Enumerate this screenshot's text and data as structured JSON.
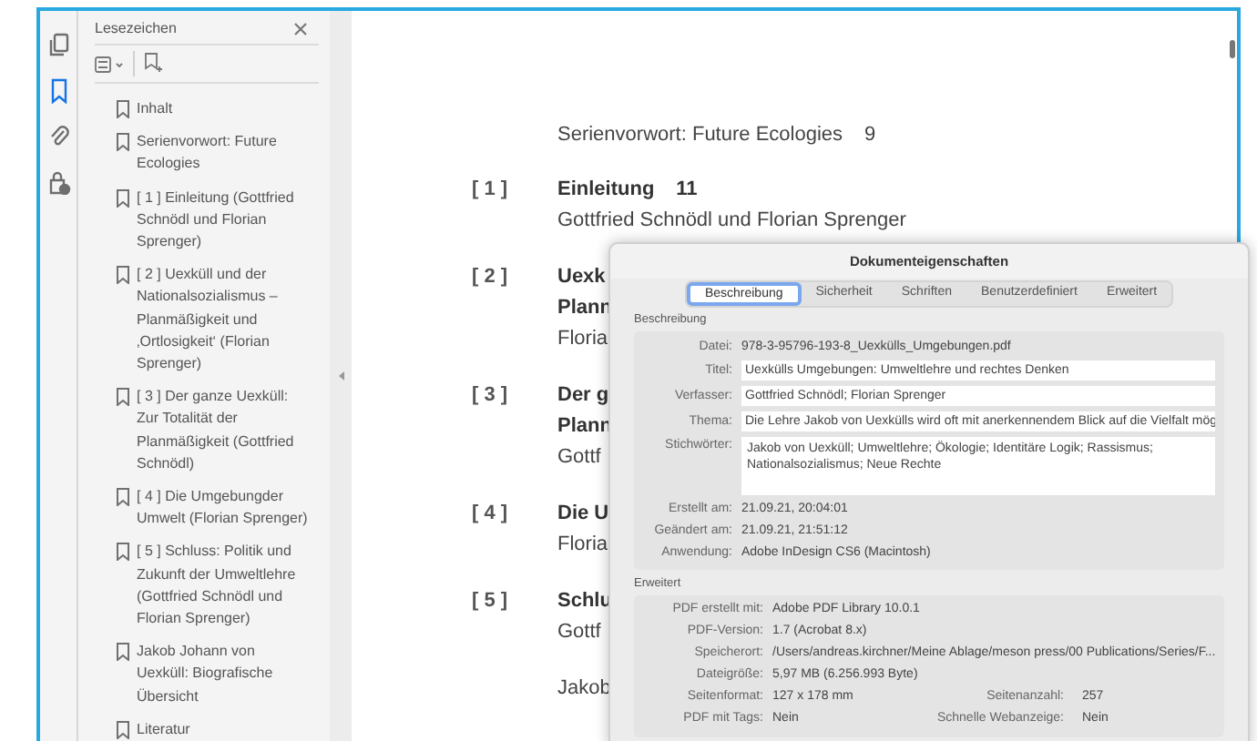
{
  "rail": [
    {
      "kind": "pages",
      "selected": false
    },
    {
      "kind": "bookmarks",
      "selected": true
    },
    {
      "kind": "attachments",
      "selected": false
    },
    {
      "kind": "security",
      "selected": false
    }
  ],
  "bookmarks_panel": {
    "title": "Lesezeichen",
    "items": [
      {
        "label": "Inhalt"
      },
      {
        "label": "Serienvorwort: Future Ecologies"
      },
      {
        "label": "[ 1 ] Einleitung (Gottfried Schnödl und Florian Sprenger)"
      },
      {
        "label": "[ 2 ] Uexküll und der Nationalsozialismus – Planmäßigkeit und ‚Ortlosigkeit‘ (Florian Sprenger)"
      },
      {
        "label": "[ 3 ] Der ganze Uexküll: Zur Totalität der Planmäßigkeit (Gottfried Schnödl)"
      },
      {
        "label": "[ 4 ] Die Umgebungder Umwelt (Florian Sprenger)"
      },
      {
        "label": "[ 5 ] Schluss: Politik und Zukunft der Umweltlehre (Gottfried Schnödl und Florian Sprenger)"
      },
      {
        "label": "Jakob Johann von Uexküll: Biografische Übersicht"
      },
      {
        "label": "Literatur"
      }
    ]
  },
  "document": {
    "entries": [
      {
        "kind": "plain",
        "text": "Serienvorwort: Future Ecologies",
        "page": "9"
      },
      {
        "kind": "chapter",
        "number": "[ 1 ]",
        "title_lines": [
          "Einleitung"
        ],
        "page": "11",
        "author": "Gottfried Schnödl und Florian Sprenger"
      },
      {
        "kind": "chapter",
        "number": "[ 2 ]",
        "title_lines": [
          "Uexk",
          "Plann"
        ],
        "author": "Floria"
      },
      {
        "kind": "chapter",
        "number": "[ 3 ]",
        "title_lines": [
          "Der g",
          "Plann"
        ],
        "author": "Gottf"
      },
      {
        "kind": "chapter",
        "number": "[ 4 ]",
        "title_lines": [
          "Die U"
        ],
        "author": "Floria"
      },
      {
        "kind": "chapter",
        "number": "[ 5 ]",
        "title_lines": [
          "Schlu"
        ],
        "author": "Gottf"
      },
      {
        "kind": "plain",
        "text": "Jakob"
      }
    ]
  },
  "dialog": {
    "title": "Dokumenteigenschaften",
    "tabs": [
      {
        "label": "Beschreibung",
        "selected": true
      },
      {
        "label": "Sicherheit",
        "selected": false
      },
      {
        "label": "Schriften",
        "selected": false
      },
      {
        "label": "Benutzerdefiniert",
        "selected": false
      },
      {
        "label": "Erweitert",
        "selected": false
      }
    ],
    "sections": [
      {
        "heading": "Beschreibung",
        "rows": [
          {
            "kind": "text",
            "label": "Datei:",
            "value": "978-3-95796-193-8_Uexkülls_Umgebungen.pdf"
          },
          {
            "kind": "input",
            "label": "Titel:",
            "value": "Uexkülls Umgebungen: Umweltlehre und rechtes Denken"
          },
          {
            "kind": "input",
            "label": "Verfasser:",
            "value": "Gottfried Schnödl; Florian Sprenger"
          },
          {
            "kind": "input",
            "label": "Thema:",
            "value": "Die Lehre Jakob von Uexkülls wird oft mit anerkennendem Blick auf die Vielfalt mög"
          },
          {
            "kind": "textarea",
            "label": "Stichwörter:",
            "value": "Jakob von Uexküll; Umweltlehre; Ökologie; Identitäre Logik; Rassismus; Nationalsozialismus; Neue Rechte"
          },
          {
            "kind": "text",
            "label": "Erstellt am:",
            "value": "21.09.21, 20:04:01"
          },
          {
            "kind": "text",
            "label": "Geändert am:",
            "value": "21.09.21, 21:51:12"
          },
          {
            "kind": "text",
            "label": "Anwendung:",
            "value": "Adobe InDesign CS6 (Macintosh)"
          }
        ]
      },
      {
        "heading": "Erweitert",
        "rows": [
          {
            "kind": "text",
            "label": "PDF erstellt mit:",
            "value": "Adobe PDF Library 10.0.1"
          },
          {
            "kind": "text",
            "label": "PDF-Version:",
            "value": "1.7 (Acrobat 8.x)"
          },
          {
            "kind": "text",
            "label": "Speicherort:",
            "value": "/Users/andreas.kirchner/Meine Ablage/meson press/00 Publications/Series/F..."
          },
          {
            "kind": "text",
            "label": "Dateigröße:",
            "value": "5,97 MB (6.256.993 Byte)"
          },
          {
            "kind": "pair",
            "label": "Seitenformat:",
            "value": "127 x 178 mm",
            "label2": "Seitenanzahl:",
            "value2": "257"
          },
          {
            "kind": "pair",
            "label": "PDF mit Tags:",
            "value": "Nein",
            "label2": "Schnelle Webanzeige:",
            "value2": "Nein"
          }
        ]
      }
    ]
  }
}
